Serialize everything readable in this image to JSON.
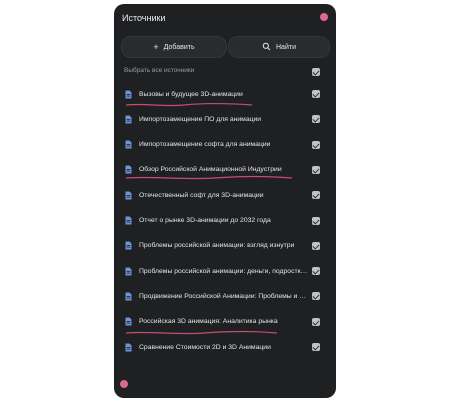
{
  "panel": {
    "title": "Источники",
    "add_label": "Добавить",
    "find_label": "Найти",
    "select_all_label": "Выбрать все источники",
    "accent_color": "#d86b8f"
  },
  "sources": [
    {
      "label": "Вызовы и будущее 3D-анимации",
      "checked": true
    },
    {
      "label": "Импортозамещение ПО для анимации",
      "checked": true
    },
    {
      "label": "Импортозамещение софта для анимации",
      "checked": true
    },
    {
      "label": "Обзор Российской Анимационной Индустрии",
      "checked": true
    },
    {
      "label": "Отечественный софт для 3D-анимации",
      "checked": true
    },
    {
      "label": "Отчет о рынке 3D-анимации до 2032 года",
      "checked": true
    },
    {
      "label": "Проблемы российской анимации: взгляд изнутри",
      "checked": true
    },
    {
      "label": "Проблемы российской анимации: деньги, подростки, ...",
      "checked": true
    },
    {
      "label": "Продвижение Российской Анимации: Проблемы и Ре...",
      "checked": true
    },
    {
      "label": "Российская 3D анимация: Аналитика рынка",
      "checked": true
    },
    {
      "label": "Сравнение Стоимости 2D и 3D Анимации",
      "checked": true
    }
  ]
}
